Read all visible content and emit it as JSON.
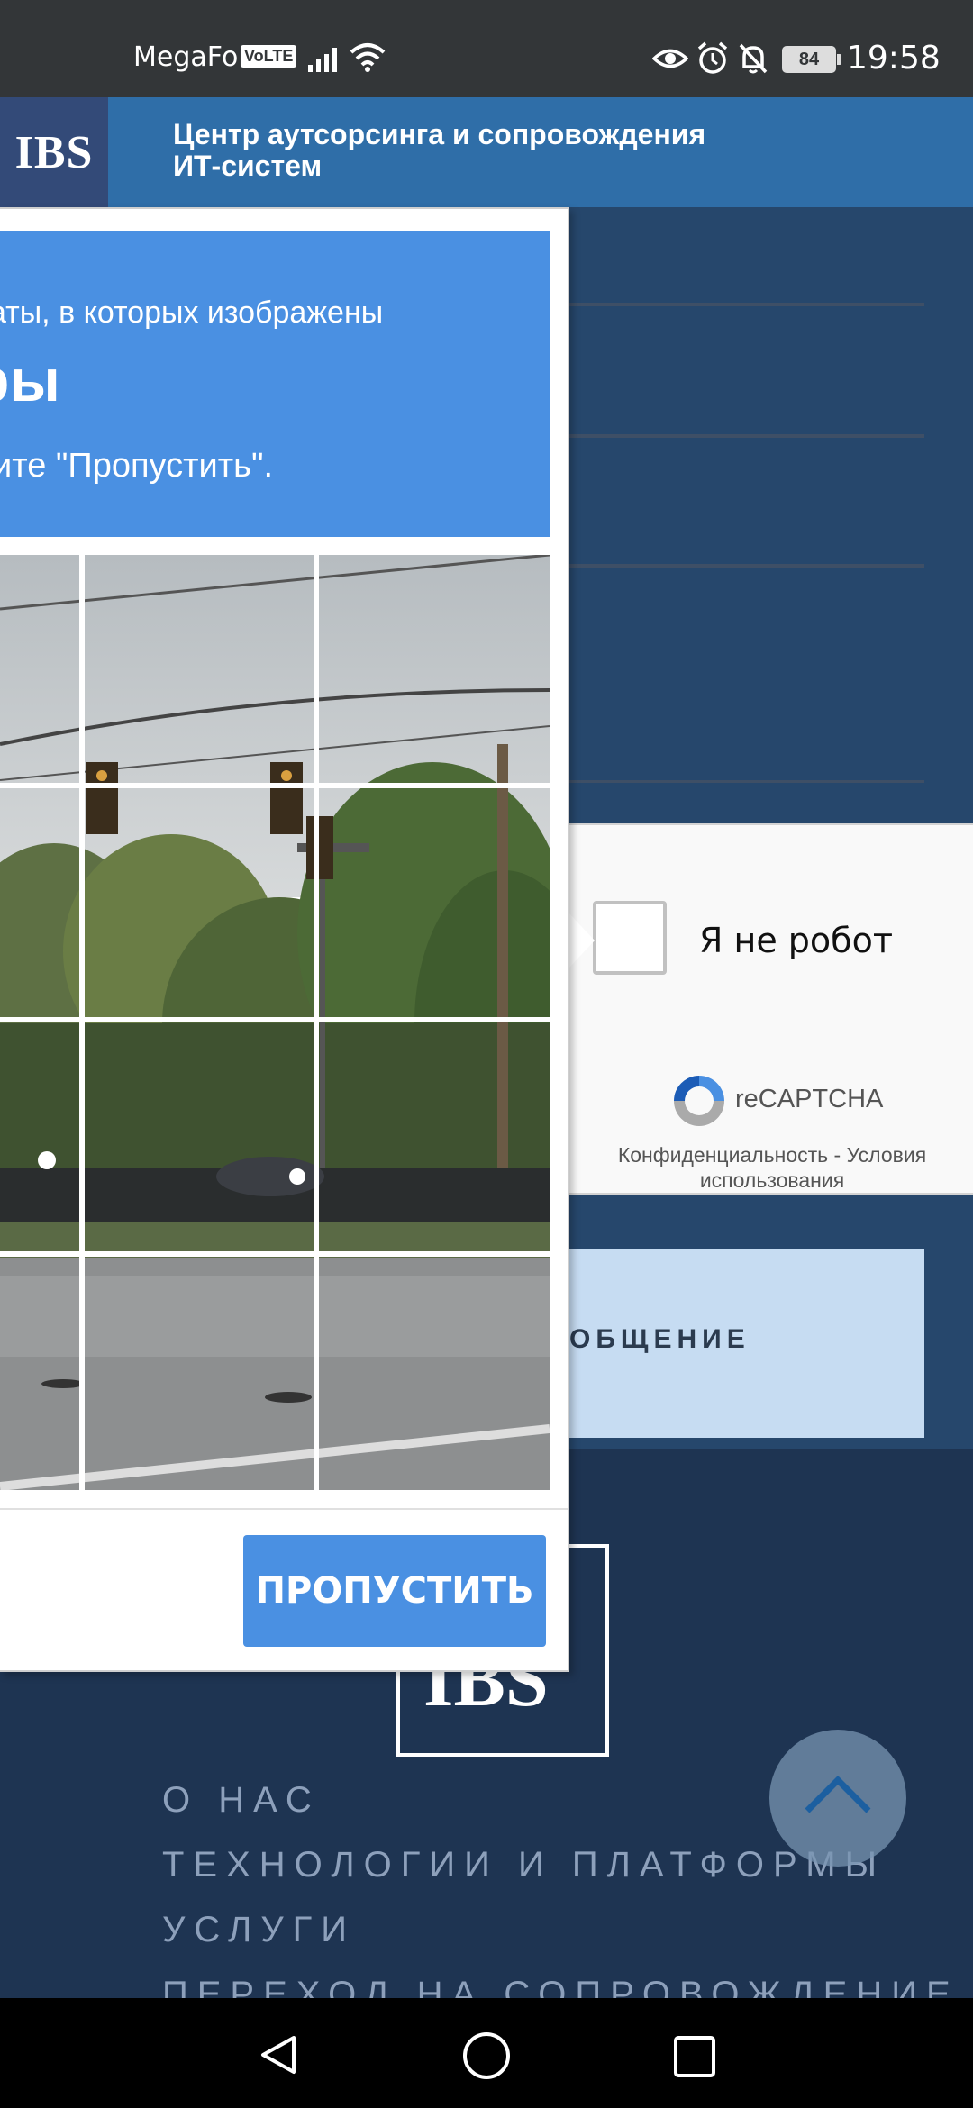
{
  "status_bar": {
    "carrier": "MegaFon",
    "volte": "VoLTE",
    "battery": "84",
    "time": "19:58"
  },
  "header": {
    "logo": "IBS",
    "title": "Центр аутсорсинга и сопровождения ИТ-систем"
  },
  "recaptcha": {
    "label": "Я не робот",
    "brand": "reCAPTCHA",
    "links": "Конфиденциальность - Условия использования"
  },
  "form": {
    "submit_label": "ОБЩЕНИЕ"
  },
  "challenge": {
    "line1": "аты, в которых изображены",
    "line2": "ры",
    "line3": "ите \"Пропустить\".",
    "skip_label": "ПРОПУСТИТЬ"
  },
  "footer": {
    "logo": "IBS",
    "nav": [
      "О НАС",
      "ТЕХНОЛОГИИ И ПЛАТФОРМЫ",
      "УСЛУГИ",
      "ПЕРЕХОД НА СОПРОВОЖДЕНИЕ"
    ]
  },
  "colors": {
    "accent": "#4a90e2",
    "header_bg": "#2f6ea8",
    "page_bg": "#26476c",
    "footer_bg": "#1e3452"
  }
}
